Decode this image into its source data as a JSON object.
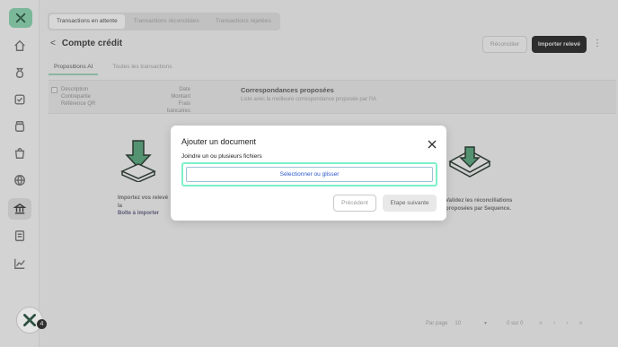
{
  "sidebar": {
    "logo_icon": "sequence-logo-icon",
    "items": [
      {
        "icon": "home-icon"
      },
      {
        "icon": "money-bag-icon"
      },
      {
        "icon": "check-square-icon"
      },
      {
        "icon": "jar-icon"
      },
      {
        "icon": "shopping-bag-icon"
      },
      {
        "icon": "globe-icon"
      },
      {
        "icon": "bank-icon",
        "active": true
      },
      {
        "icon": "receipt-icon"
      },
      {
        "icon": "chart-icon"
      }
    ],
    "badge_count": "4"
  },
  "topbar": {
    "tabs": [
      "Transactions en attente",
      "Transactions réconciliées",
      "Transactions rejetées"
    ]
  },
  "page": {
    "title": "Compte crédit",
    "reconcile_label": "Réconcilier",
    "import_label": "Importer relevé",
    "subtabs": [
      "Propositions AI",
      "Toutes les transactions"
    ]
  },
  "table": {
    "left_col": [
      "Description",
      "Contrepartie",
      "Référence QR"
    ],
    "right_col": [
      "Date",
      "Montant",
      "Frais bancaires"
    ],
    "correspondences_title": "Correspondances proposées",
    "correspondences_sub": "Liste avec la meilleure correspondance proposée par l'IA"
  },
  "empty_state": {
    "left_text_1": "Importez vos relevé",
    "left_text_2": "la",
    "left_link": "Boîte à importer",
    "right_text_1": "Validez les réconciliations",
    "right_text_2": "proposées par Sequence."
  },
  "pagination": {
    "per_page_label": "Par page",
    "per_page_value": "10",
    "range": "0 sur 0"
  },
  "modal": {
    "title": "Ajouter un document",
    "subtitle": "Joindre un ou plusieurs fichiers",
    "dropzone_label": "Sélectionner ou glisser",
    "prev_label": "Précédent",
    "next_label": "Etape suivante"
  },
  "colors": {
    "accent": "#7cf0c8",
    "link": "#2a57c7",
    "dark_button": "#1f1f1f"
  }
}
